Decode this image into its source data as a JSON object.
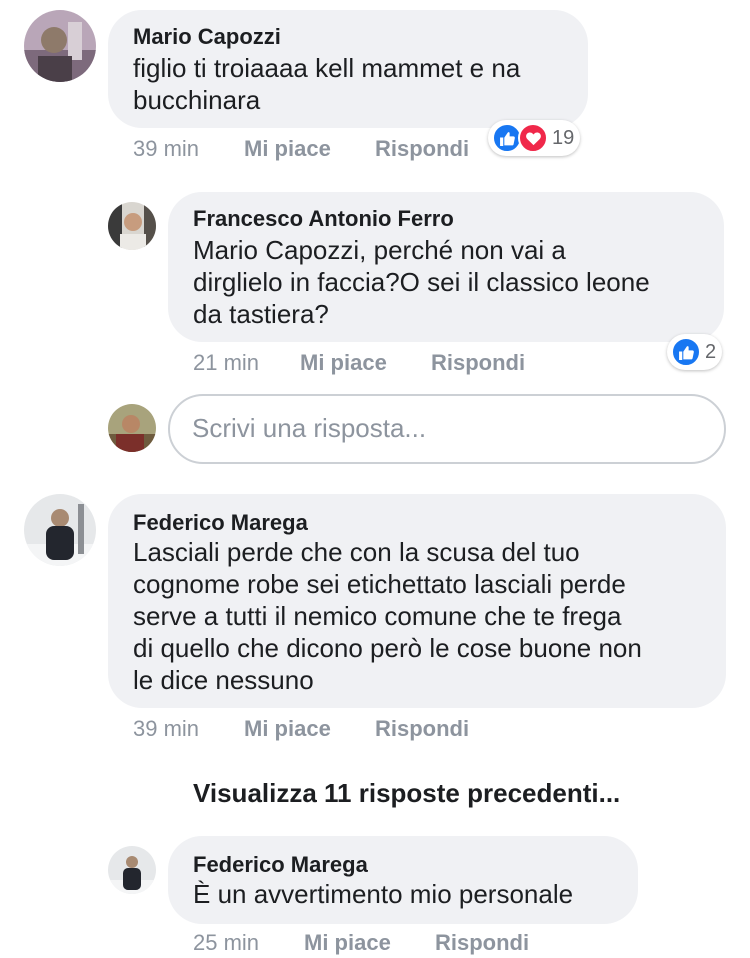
{
  "comments": [
    {
      "author": "Mario Capozzi",
      "text_lines": [
        "figlio ti troiaaaa kell mammet e na",
        "bucchinara"
      ],
      "time": "39 min",
      "like_label": "Mi piace",
      "reply_label": "Rispondi",
      "reactions": {
        "types": [
          "like",
          "love"
        ],
        "count": "19"
      }
    },
    {
      "author": "Francesco Antonio Ferro",
      "text_lines": [
        "Mario Capozzi, perché non vai a",
        "dirglielo in faccia?O sei il classico leone",
        "da tastiera?"
      ],
      "time": "21 min",
      "like_label": "Mi piace",
      "reply_label": "Rispondi",
      "reactions": {
        "types": [
          "like"
        ],
        "count": "2"
      }
    },
    {
      "author": "Federico Marega",
      "text_lines": [
        "Lasciali perde che con la scusa del tuo",
        "cognome robe sei etichettato lasciali perde",
        "serve a tutti il nemico comune che te frega",
        "di quello che dicono però le cose buone non",
        "le dice nessuno"
      ],
      "time": "39 min",
      "like_label": "Mi piace",
      "reply_label": "Rispondi"
    },
    {
      "author": "Federico Marega",
      "text_lines": [
        "È un avvertimento mio personale"
      ],
      "time": "25 min",
      "like_label": "Mi piace",
      "reply_label": "Rispondi"
    }
  ],
  "reply_input": {
    "placeholder": "Scrivi una risposta..."
  },
  "view_more": {
    "label": "Visualizza 11 risposte precedenti..."
  },
  "colors": {
    "like": "#1877f2",
    "love": "#f0284a",
    "bubble": "#f0f1f4",
    "meta": "#8d949e"
  },
  "icons": [
    "thumbs-up-icon",
    "heart-icon"
  ]
}
